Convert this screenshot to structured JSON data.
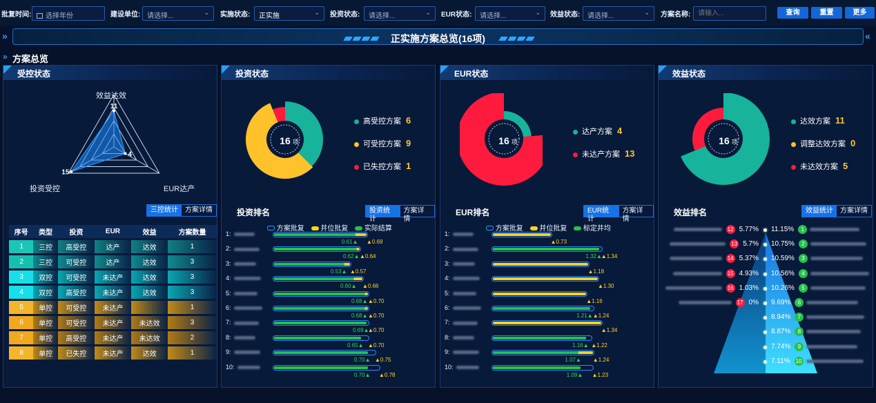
{
  "filters": {
    "approve_time": {
      "label": "批复时间:",
      "placeholder": "选择年份"
    },
    "build_unit": {
      "label": "建设单位:",
      "placeholder": "请选择..."
    },
    "impl_status": {
      "label": "实施状态:",
      "value": "正实施"
    },
    "invest_status": {
      "label": "投资状态:",
      "placeholder": "请选择..."
    },
    "eur_status": {
      "label": "EUR状态:",
      "placeholder": "请选择..."
    },
    "benefit_status": {
      "label": "效益状态:",
      "placeholder": "请选择..."
    },
    "plan_name": {
      "label": "方案名称:",
      "placeholder": "请输入..."
    },
    "buttons": {
      "query": "查询",
      "reset": "重置",
      "more": "更多"
    }
  },
  "banner": {
    "title": "正实施方案总览(16项)"
  },
  "overview_title": "方案总览",
  "panels": {
    "control": {
      "title": "受控状态",
      "radar": {
        "axes": [
          "效益达效",
          "EUR达产",
          "投资受控"
        ],
        "values": [
          11,
          4,
          15
        ]
      },
      "toggle": [
        "三控统计",
        "方案详情"
      ],
      "table": {
        "headers": [
          "序号",
          "类型",
          "投资",
          "EUR",
          "效益",
          "方案数量"
        ],
        "rows": [
          [
            "1",
            "三控",
            "高受控",
            "达产",
            "达效",
            "1"
          ],
          [
            "2",
            "三控",
            "可受控",
            "达产",
            "达效",
            "3"
          ],
          [
            "3",
            "双控",
            "可受控",
            "未达产",
            "达效",
            "3"
          ],
          [
            "4",
            "双控",
            "高受控",
            "未达产",
            "达效",
            "3"
          ],
          [
            "5",
            "单控",
            "可受控",
            "未达产",
            "",
            "1"
          ],
          [
            "6",
            "单控",
            "可受控",
            "未达产",
            "未达效",
            "3"
          ],
          [
            "7",
            "单控",
            "高受控",
            "未达产",
            "未达效",
            "2"
          ],
          [
            "8",
            "单控",
            "已失控",
            "未达产",
            "达效",
            "1"
          ]
        ]
      }
    },
    "invest": {
      "title": "投资状态",
      "center": {
        "value": "16",
        "unit": "项"
      },
      "legend": [
        {
          "label": "高受控方案",
          "value": "6",
          "color": "#17b39b"
        },
        {
          "label": "可受控方案",
          "value": "9",
          "color": "#ffc22a"
        },
        {
          "label": "已失控方案",
          "value": "1",
          "color": "#ff1b3d"
        }
      ],
      "rank_title": "投资排名",
      "toggle": [
        "投资统计",
        "方案详情"
      ],
      "series_legend": [
        "方案批复",
        "并位批复",
        "实际结算"
      ]
    },
    "eur": {
      "title": "EUR状态",
      "center": {
        "value": "16",
        "unit": "项"
      },
      "legend": [
        {
          "label": "达产方案",
          "value": "4",
          "color": "#17b39b"
        },
        {
          "label": "未达产方案",
          "value": "13",
          "color": "#ff1b3d"
        }
      ],
      "rank_title": "EUR排名",
      "toggle": [
        "EUR统计",
        "方案详情"
      ],
      "series_legend": [
        "方案批复",
        "并位批复",
        "标定井均"
      ]
    },
    "benefit": {
      "title": "效益状态",
      "center": {
        "value": "16",
        "unit": "项"
      },
      "legend": [
        {
          "label": "达效方案",
          "value": "11",
          "color": "#17b39b"
        },
        {
          "label": "调整达效方案",
          "value": "0",
          "color": "#ffc22a"
        },
        {
          "label": "未达效方案",
          "value": "5",
          "color": "#ff1b3d"
        }
      ],
      "rank_title": "效益排名",
      "toggle": [
        "效益统计",
        "方案详情"
      ]
    }
  },
  "chart_data": [
    {
      "type": "radar",
      "axes": [
        "效益达效",
        "EUR达产",
        "投资受控"
      ],
      "values": [
        11,
        4,
        15
      ]
    },
    {
      "type": "pie",
      "center_label": "16 项",
      "categories": [
        "高受控方案",
        "可受控方案",
        "已失控方案"
      ],
      "values": [
        6,
        9,
        1
      ],
      "colors": [
        "#17b39b",
        "#ffc22a",
        "#ff1b3d"
      ]
    },
    {
      "type": "pie",
      "center_label": "16 项",
      "categories": [
        "达产方案",
        "未达产方案"
      ],
      "values": [
        4,
        13
      ],
      "colors": [
        "#17b39b",
        "#ff1b3d"
      ]
    },
    {
      "type": "pie",
      "center_label": "16 项",
      "categories": [
        "达效方案",
        "调整达效方案",
        "未达效方案"
      ],
      "values": [
        11,
        0,
        5
      ],
      "colors": [
        "#17b39b",
        "#ffc22a",
        "#ff1b3d"
      ]
    },
    {
      "type": "bar",
      "title": "投资排名",
      "categories": [
        "1",
        "2",
        "3",
        "4",
        "5",
        "6",
        "7",
        "8",
        "9",
        "10"
      ],
      "series": [
        {
          "name": "方案批复",
          "values": [
            0.69,
            0.64,
            0.57,
            0.66,
            0.7,
            0.7,
            0.7,
            0.7,
            0.75,
            0.78
          ]
        },
        {
          "name": "并位批复",
          "values": [
            0.69,
            0.64,
            0.57,
            0.66,
            0.7,
            0.7,
            0.69,
            0.65,
            0.7,
            0.7
          ]
        },
        {
          "name": "实际结算",
          "values": [
            0.61,
            0.62,
            0.53,
            0.6,
            0.68,
            0.68,
            0.69,
            0.65,
            0.7,
            0.7
          ]
        }
      ],
      "labels": {
        "left": [
          "0.61",
          "0.62",
          "0.53",
          "0.60",
          "0.68",
          "0.68",
          "0.69",
          "0.65",
          "0.70",
          "0.70"
        ],
        "right": [
          "0.69",
          "0.64",
          "0.57",
          "0.66",
          "0.70",
          "0.70",
          "0.70",
          "0.70",
          "0.75",
          "0.78"
        ]
      }
    },
    {
      "type": "bar",
      "title": "EUR排名",
      "categories": [
        "1",
        "2",
        "3",
        "4",
        "5",
        "6",
        "7",
        "8",
        "9",
        "10"
      ],
      "series": [
        {
          "name": "方案批复",
          "values": [
            0.73,
            1.34,
            1.18,
            1.3,
            1.16,
            1.24,
            1.34,
            1.22,
            1.24,
            1.23
          ]
        },
        {
          "name": "并位批复",
          "values": [
            0.73,
            1.32,
            1.18,
            1.3,
            1.16,
            1.21,
            1.34,
            1.16,
            1.24,
            1.09
          ]
        },
        {
          "name": "标定井均",
          "values": [
            0.0,
            1.32,
            0.0,
            0.0,
            0.0,
            1.21,
            0.0,
            1.16,
            1.07,
            1.09
          ]
        }
      ],
      "labels": {
        "left": [
          "",
          "1.32",
          "",
          "",
          "",
          "1.21",
          "",
          "1.16",
          "1.07",
          "1.09"
        ],
        "right": [
          "0.73",
          "1.34",
          "1.18",
          "1.30",
          "1.16",
          "1.24",
          "1.34",
          "1.22",
          "1.24",
          "1.23"
        ]
      }
    },
    {
      "type": "table",
      "title": "效益排名",
      "left": [
        {
          "rank": "12",
          "value": "5.77%"
        },
        {
          "rank": "13",
          "value": "5.7%"
        },
        {
          "rank": "14",
          "value": "5.37%"
        },
        {
          "rank": "15",
          "value": "4.93%"
        },
        {
          "rank": "16",
          "value": "1.03%"
        },
        {
          "rank": "17",
          "value": "0%"
        }
      ],
      "right": [
        {
          "rank": "1",
          "value": "11.15%"
        },
        {
          "rank": "2",
          "value": "10.75%"
        },
        {
          "rank": "3",
          "value": "10.59%"
        },
        {
          "rank": "4",
          "value": "10.56%"
        },
        {
          "rank": "5",
          "value": "10.26%"
        },
        {
          "rank": "6",
          "value": "9.69%"
        },
        {
          "rank": "7",
          "value": "8.94%"
        },
        {
          "rank": "8",
          "value": "8.87%"
        },
        {
          "rank": "9",
          "value": "7.74%"
        },
        {
          "rank": "10",
          "value": "7.11%"
        }
      ]
    }
  ]
}
